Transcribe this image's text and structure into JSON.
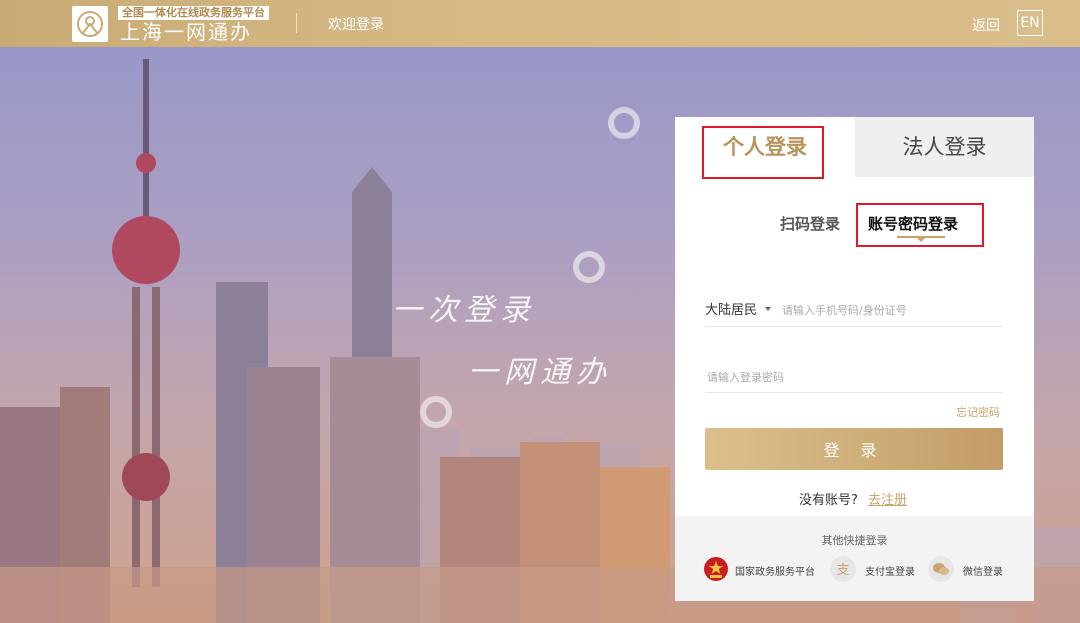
{
  "header": {
    "logo_tagline": "全国一体化在线政务服务平台",
    "logo_title": "上海一网通办",
    "welcome": "欢迎登录",
    "back": "返回",
    "lang": "EN"
  },
  "hero": {
    "slogan_line1": "一次登录",
    "slogan_line2": "一网通办"
  },
  "login": {
    "tabs": [
      {
        "label": "个人登录",
        "active": true
      },
      {
        "label": "法人登录",
        "active": false
      }
    ],
    "subtabs": [
      {
        "label": "扫码登录",
        "active": false
      },
      {
        "label": "账号密码登录",
        "active": true
      }
    ],
    "region_select": "大陆居民",
    "account_placeholder": "请输入手机号码/身份证号",
    "password_placeholder": "请输入登录密码",
    "forgot_password": "忘记密码",
    "submit": "登 录",
    "no_account": "没有账号?",
    "register": "去注册",
    "quick_login": {
      "title": "其他快捷登录",
      "items": [
        {
          "label": "国家政务服务平台",
          "icon": "national-emblem-icon"
        },
        {
          "label": "支付宝登录",
          "icon": "alipay-icon"
        },
        {
          "label": "微信登录",
          "icon": "wechat-icon"
        }
      ]
    }
  },
  "colors": {
    "accent_gold": "#c9a36a",
    "highlight_red": "#e2182a",
    "header_gold": "#d6ba86"
  }
}
